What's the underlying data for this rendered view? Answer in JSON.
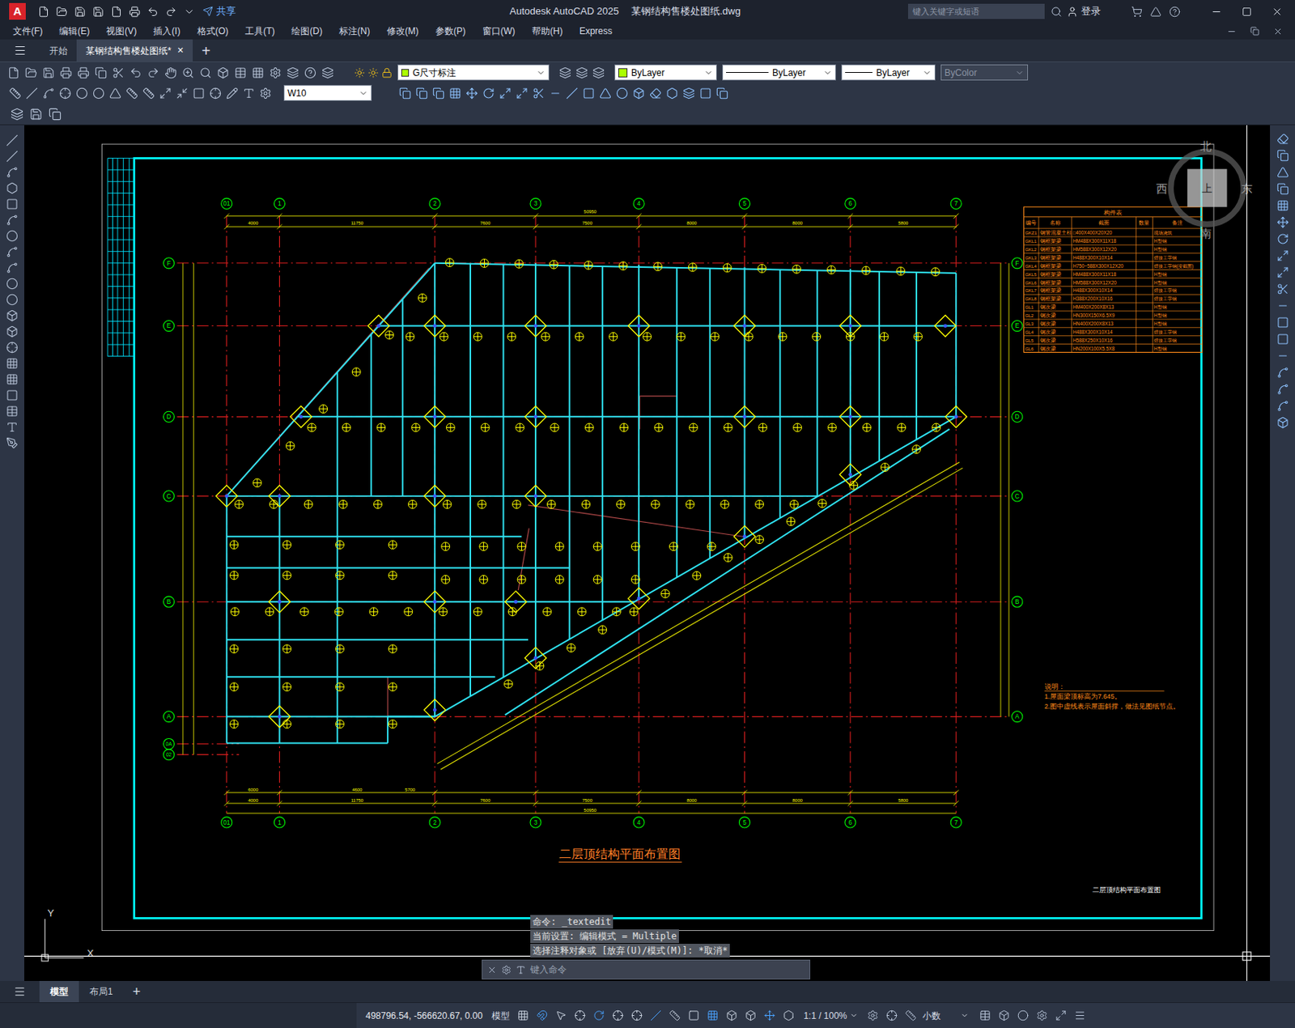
{
  "window": {
    "app_icon": "A",
    "title": "Autodesk AutoCAD 2025",
    "file": "某钢结构售楼处图纸.dwg",
    "share": "共享",
    "search_placeholder": "键入关键字或短语",
    "login": "登录"
  },
  "menu": [
    "文件(F)",
    "编辑(E)",
    "视图(V)",
    "插入(I)",
    "格式(O)",
    "工具(T)",
    "绘图(D)",
    "标注(N)",
    "修改(M)",
    "参数(P)",
    "窗口(W)",
    "帮助(H)",
    "Express"
  ],
  "doc_tabs": [
    {
      "label": "开始",
      "selected": false
    },
    {
      "label": "某钢结构售楼处图纸*",
      "selected": true
    }
  ],
  "doc_tab_close": "×",
  "doc_tab_add": "+",
  "properties": {
    "layer": "G尺寸标注",
    "color": "ByLayer",
    "linetype": "ByLayer",
    "lineweight": "ByLayer",
    "plotstyle": "ByColor",
    "dimstyle": "W10"
  },
  "drawing": {
    "column_axes": [
      "01",
      "1",
      "2",
      "3",
      "4",
      "5",
      "6",
      "7"
    ],
    "row_axes": [
      "F",
      "E",
      "D",
      "C",
      "B",
      "A",
      "0A",
      "02"
    ],
    "top_total": "50950",
    "top_segments": [
      "4000",
      "11750",
      "7600",
      "7500",
      "8000",
      "8000",
      "5800"
    ],
    "bottom_row1": [
      "6000",
      "4600",
      "5700"
    ],
    "bottom_row2": [
      "4000",
      "11750",
      "7600",
      "7500",
      "8000",
      "8000",
      "5800"
    ],
    "bottom_total": "50950",
    "table": {
      "title": "构件表",
      "header": [
        "编号",
        "名称",
        "截面",
        "数量",
        "备注"
      ],
      "rows": [
        {
          "id": "GKZ1",
          "name": "钢管混凝土柱",
          "section": "□400X400X20X20",
          "note": "现场浇筑"
        },
        {
          "id": "GKL1",
          "name": "钢框架梁",
          "section": "HM488X300X11X18",
          "note": "H型钢"
        },
        {
          "id": "GKL2",
          "name": "钢框架梁",
          "section": "HM588X300X12X20",
          "note": "H型钢"
        },
        {
          "id": "GKL3",
          "name": "钢框架梁",
          "section": "H488X300X10X14",
          "note": "焊接工字钢"
        },
        {
          "id": "GKL4",
          "name": "钢框架梁",
          "section": "H750~588X300X12X20",
          "note": "焊接工字钢(变截面)"
        },
        {
          "id": "GKL5",
          "name": "钢框架梁",
          "section": "HM488X300X11X18",
          "note": "H型钢"
        },
        {
          "id": "GKL6",
          "name": "钢框架梁",
          "section": "HM588X300X12X20",
          "note": "H型钢"
        },
        {
          "id": "GKL7",
          "name": "钢框架梁",
          "section": "H488X300X10X14",
          "note": "焊接工字钢"
        },
        {
          "id": "GKL8",
          "name": "钢框架梁",
          "section": "H388X200X10X16",
          "note": "焊接工字钢"
        },
        {
          "id": "GL1",
          "name": "钢次梁",
          "section": "HM400X200X8X13",
          "note": "H型钢"
        },
        {
          "id": "GL2",
          "name": "钢次梁",
          "section": "HN300X150X6.5X9",
          "note": "H型钢"
        },
        {
          "id": "GL3",
          "name": "钢次梁",
          "section": "HN400X200X8X13",
          "note": "H型钢"
        },
        {
          "id": "GL4",
          "name": "钢次梁",
          "section": "H488X300X10X14",
          "note": "焊接工字钢"
        },
        {
          "id": "GL5",
          "name": "钢次梁",
          "section": "H588X250X10X16",
          "note": "焊接工字钢"
        },
        {
          "id": "GL6",
          "name": "钢次梁",
          "section": "HN200X100X5.5X8",
          "note": "H型钢"
        }
      ]
    },
    "notes": [
      "说明：",
      "1.屋面梁顶标高为7.645。",
      "2.图中虚线表示屋面斜撑，做法见图纸节点。"
    ],
    "title": "二层顶结构平面布置图",
    "title_block": "二层顶结构平面布置图"
  },
  "viewcube": {
    "north": "北",
    "south": "南",
    "east": "东",
    "west": "西",
    "top": "上"
  },
  "ucs": {
    "x": "X",
    "y": "Y"
  },
  "command": {
    "history": [
      "命令: _textedit",
      "当前设置: 编辑模式 = Multiple",
      "选择注释对象或 [放弃(U)/模式(M)]: *取消*"
    ],
    "placeholder": "键入命令"
  },
  "layout_tabs": [
    {
      "label": "模型",
      "selected": true
    },
    {
      "label": "布局1",
      "selected": false
    }
  ],
  "layout_tab_add": "+",
  "status": {
    "coords": "498796.54, -566620.67, 0.00",
    "space": "模型",
    "scale": "1:1 / 100%",
    "units": "小数"
  }
}
